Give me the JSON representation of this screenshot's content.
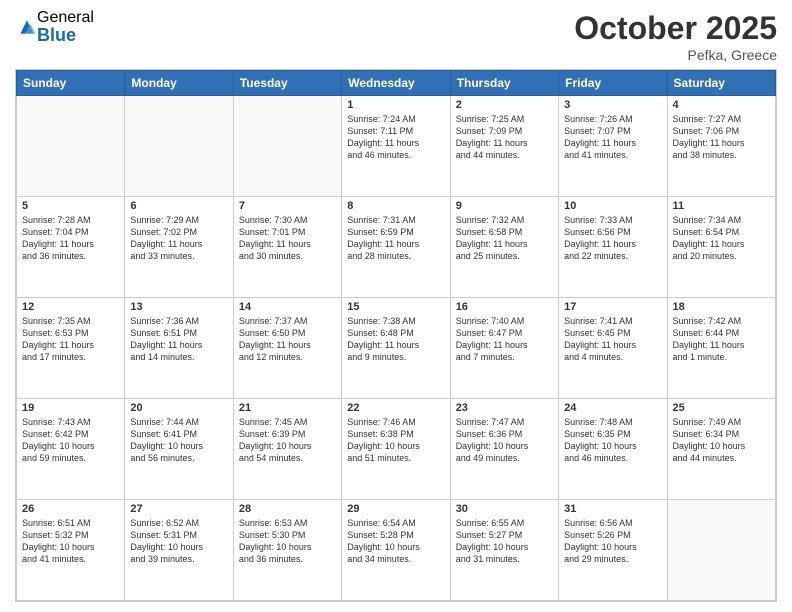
{
  "logo": {
    "general": "General",
    "blue": "Blue"
  },
  "header": {
    "month": "October 2025",
    "location": "Pefka, Greece"
  },
  "weekdays": [
    "Sunday",
    "Monday",
    "Tuesday",
    "Wednesday",
    "Thursday",
    "Friday",
    "Saturday"
  ],
  "weeks": [
    [
      {
        "day": "",
        "info": ""
      },
      {
        "day": "",
        "info": ""
      },
      {
        "day": "",
        "info": ""
      },
      {
        "day": "1",
        "info": "Sunrise: 7:24 AM\nSunset: 7:11 PM\nDaylight: 11 hours\nand 46 minutes."
      },
      {
        "day": "2",
        "info": "Sunrise: 7:25 AM\nSunset: 7:09 PM\nDaylight: 11 hours\nand 44 minutes."
      },
      {
        "day": "3",
        "info": "Sunrise: 7:26 AM\nSunset: 7:07 PM\nDaylight: 11 hours\nand 41 minutes."
      },
      {
        "day": "4",
        "info": "Sunrise: 7:27 AM\nSunset: 7:06 PM\nDaylight: 11 hours\nand 38 minutes."
      }
    ],
    [
      {
        "day": "5",
        "info": "Sunrise: 7:28 AM\nSunset: 7:04 PM\nDaylight: 11 hours\nand 36 minutes."
      },
      {
        "day": "6",
        "info": "Sunrise: 7:29 AM\nSunset: 7:02 PM\nDaylight: 11 hours\nand 33 minutes."
      },
      {
        "day": "7",
        "info": "Sunrise: 7:30 AM\nSunset: 7:01 PM\nDaylight: 11 hours\nand 30 minutes."
      },
      {
        "day": "8",
        "info": "Sunrise: 7:31 AM\nSunset: 6:59 PM\nDaylight: 11 hours\nand 28 minutes."
      },
      {
        "day": "9",
        "info": "Sunrise: 7:32 AM\nSunset: 6:58 PM\nDaylight: 11 hours\nand 25 minutes."
      },
      {
        "day": "10",
        "info": "Sunrise: 7:33 AM\nSunset: 6:56 PM\nDaylight: 11 hours\nand 22 minutes."
      },
      {
        "day": "11",
        "info": "Sunrise: 7:34 AM\nSunset: 6:54 PM\nDaylight: 11 hours\nand 20 minutes."
      }
    ],
    [
      {
        "day": "12",
        "info": "Sunrise: 7:35 AM\nSunset: 6:53 PM\nDaylight: 11 hours\nand 17 minutes."
      },
      {
        "day": "13",
        "info": "Sunrise: 7:36 AM\nSunset: 6:51 PM\nDaylight: 11 hours\nand 14 minutes."
      },
      {
        "day": "14",
        "info": "Sunrise: 7:37 AM\nSunset: 6:50 PM\nDaylight: 11 hours\nand 12 minutes."
      },
      {
        "day": "15",
        "info": "Sunrise: 7:38 AM\nSunset: 6:48 PM\nDaylight: 11 hours\nand 9 minutes."
      },
      {
        "day": "16",
        "info": "Sunrise: 7:40 AM\nSunset: 6:47 PM\nDaylight: 11 hours\nand 7 minutes."
      },
      {
        "day": "17",
        "info": "Sunrise: 7:41 AM\nSunset: 6:45 PM\nDaylight: 11 hours\nand 4 minutes."
      },
      {
        "day": "18",
        "info": "Sunrise: 7:42 AM\nSunset: 6:44 PM\nDaylight: 11 hours\nand 1 minute."
      }
    ],
    [
      {
        "day": "19",
        "info": "Sunrise: 7:43 AM\nSunset: 6:42 PM\nDaylight: 10 hours\nand 59 minutes."
      },
      {
        "day": "20",
        "info": "Sunrise: 7:44 AM\nSunset: 6:41 PM\nDaylight: 10 hours\nand 56 minutes."
      },
      {
        "day": "21",
        "info": "Sunrise: 7:45 AM\nSunset: 6:39 PM\nDaylight: 10 hours\nand 54 minutes."
      },
      {
        "day": "22",
        "info": "Sunrise: 7:46 AM\nSunset: 6:38 PM\nDaylight: 10 hours\nand 51 minutes."
      },
      {
        "day": "23",
        "info": "Sunrise: 7:47 AM\nSunset: 6:36 PM\nDaylight: 10 hours\nand 49 minutes."
      },
      {
        "day": "24",
        "info": "Sunrise: 7:48 AM\nSunset: 6:35 PM\nDaylight: 10 hours\nand 46 minutes."
      },
      {
        "day": "25",
        "info": "Sunrise: 7:49 AM\nSunset: 6:34 PM\nDaylight: 10 hours\nand 44 minutes."
      }
    ],
    [
      {
        "day": "26",
        "info": "Sunrise: 6:51 AM\nSunset: 5:32 PM\nDaylight: 10 hours\nand 41 minutes."
      },
      {
        "day": "27",
        "info": "Sunrise: 6:52 AM\nSunset: 5:31 PM\nDaylight: 10 hours\nand 39 minutes."
      },
      {
        "day": "28",
        "info": "Sunrise: 6:53 AM\nSunset: 5:30 PM\nDaylight: 10 hours\nand 36 minutes."
      },
      {
        "day": "29",
        "info": "Sunrise: 6:54 AM\nSunset: 5:28 PM\nDaylight: 10 hours\nand 34 minutes."
      },
      {
        "day": "30",
        "info": "Sunrise: 6:55 AM\nSunset: 5:27 PM\nDaylight: 10 hours\nand 31 minutes."
      },
      {
        "day": "31",
        "info": "Sunrise: 6:56 AM\nSunset: 5:26 PM\nDaylight: 10 hours\nand 29 minutes."
      },
      {
        "day": "",
        "info": ""
      }
    ]
  ]
}
